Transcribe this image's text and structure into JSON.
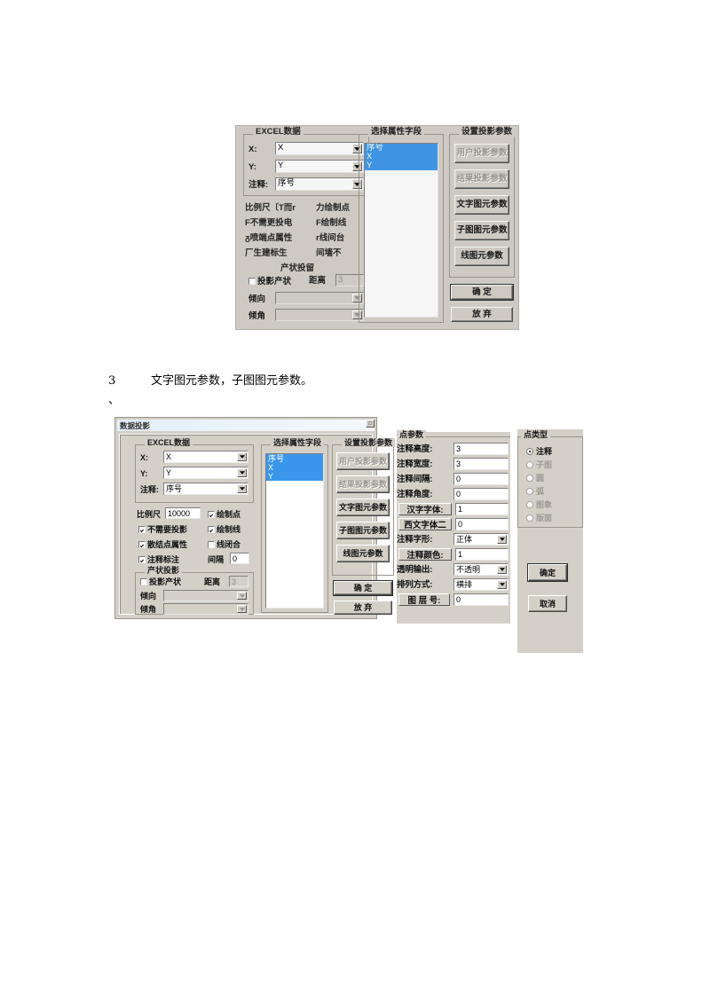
{
  "document": {
    "paragraph_number": "3",
    "paragraph_text": "文字图元参数，子图图元参数。",
    "trailing_mark": "、"
  },
  "top_screenshot": {
    "excel_group": {
      "title": "EXCEL数据",
      "rows": [
        {
          "label": "X:",
          "value": "X"
        },
        {
          "label": "Y:",
          "value": "Y"
        },
        {
          "label": "注释:",
          "value": "序号"
        }
      ]
    },
    "options_text": [
      "比例尺〔T而r",
      "力绘制点",
      "F不需更投电",
      "F绘制线",
      "ᵹ喷端点属性",
      "r线间台",
      "厂生建标生",
      "间墙不"
    ],
    "attitude_group": {
      "title": "产状投留",
      "checkbox_label": "投影产状",
      "distance_label": "距离",
      "distance_value": "3",
      "dip_direction_label": "倾向",
      "dip_angle_label": "倾角"
    },
    "field_list": {
      "title": "选择属性字段",
      "items": [
        {
          "label": "序号",
          "selected": true
        },
        {
          "label": "X",
          "selected": true
        },
        {
          "label": "Y",
          "selected": true
        }
      ]
    },
    "projection_group": {
      "title": "设置投影参数",
      "buttons": [
        {
          "label": "用户投影参数",
          "disabled": true
        },
        {
          "label": "结果投影参数",
          "disabled": true
        },
        {
          "label": "文字图元参数",
          "disabled": false
        },
        {
          "label": "子图图元参数",
          "disabled": false
        },
        {
          "label": "线图元参数",
          "disabled": false
        }
      ]
    },
    "ok_label": "确  定",
    "cancel_label": "放  弃"
  },
  "dialog": {
    "title": "数据投影",
    "close_glyph": "□",
    "excel_group": {
      "title": "EXCEL数据",
      "rows": [
        {
          "label": "X:",
          "value": "X"
        },
        {
          "label": "Y:",
          "value": "Y"
        },
        {
          "label": "注释:",
          "value": "序号"
        }
      ]
    },
    "scale_label": "比例尺",
    "scale_value": "10000",
    "interval_label": "间隔",
    "interval_value": "0",
    "checkboxes": [
      {
        "label": "绘制点",
        "checked": true
      },
      {
        "label": "不需要投影",
        "checked": true
      },
      {
        "label": "绘制线",
        "checked": true
      },
      {
        "label": "散结点属性",
        "checked": true
      },
      {
        "label": "线闭合",
        "checked": false
      },
      {
        "label": "注释标注",
        "checked": true
      }
    ],
    "attitude_group": {
      "title": "产状投影",
      "checkbox_label": "投影产状",
      "checked": false,
      "distance_label": "距离",
      "distance_value": "3",
      "dip_direction_label": "倾向",
      "dip_direction_value": "",
      "dip_angle_label": "倾角",
      "dip_angle_value": ""
    },
    "field_list": {
      "title": "选择属性字段",
      "items": [
        {
          "label": "序号",
          "selected": true
        },
        {
          "label": "X",
          "selected": true
        },
        {
          "label": "Y",
          "selected": true
        }
      ]
    },
    "projection_group": {
      "title": "设置投影参数",
      "buttons": [
        {
          "label": "用户投影参数",
          "disabled": true
        },
        {
          "label": "结果投影参数",
          "disabled": true
        },
        {
          "label": "文字图元参数",
          "disabled": false
        },
        {
          "label": "子图图元参数",
          "disabled": false
        },
        {
          "label": "线图元参数",
          "disabled": false
        }
      ]
    },
    "ok_label": "确  定",
    "cancel_label": "放  弃"
  },
  "point_params": {
    "title": "点参数",
    "rows": [
      {
        "label": "注释高度:",
        "value": "3",
        "kind": "text"
      },
      {
        "label": "注释宽度:",
        "value": "3",
        "kind": "text"
      },
      {
        "label": "注释间隔:",
        "value": "0",
        "kind": "text"
      },
      {
        "label": "注释角度:",
        "value": "0",
        "kind": "text"
      },
      {
        "label": "汉字字体:",
        "value": "1",
        "kind": "button-label"
      },
      {
        "label": "西文字体二",
        "value": "0",
        "kind": "button-label"
      },
      {
        "label": "注释字形:",
        "value": "正体",
        "kind": "combo"
      },
      {
        "label": "注释颜色:",
        "value": "1",
        "kind": "button-label"
      },
      {
        "label": "透明输出:",
        "value": "不透明",
        "kind": "combo"
      },
      {
        "label": "排列方式:",
        "value": "横排",
        "kind": "combo"
      },
      {
        "label": "图 层 号:",
        "value": "0",
        "kind": "text"
      }
    ]
  },
  "point_type": {
    "title": "点类型",
    "options": [
      {
        "label": "注释",
        "selected": true,
        "disabled": false
      },
      {
        "label": "子图",
        "selected": false,
        "disabled": true
      },
      {
        "label": "圆",
        "selected": false,
        "disabled": true
      },
      {
        "label": "弧",
        "selected": false,
        "disabled": true
      },
      {
        "label": "图象",
        "selected": false,
        "disabled": true
      },
      {
        "label": "版面",
        "selected": false,
        "disabled": true
      }
    ],
    "ok_label": "确定",
    "cancel_label": "取消"
  },
  "colors": {
    "selection_blue": "#3a96eb",
    "window_face": "#d4d0c8",
    "field_white": "#ffffff",
    "disabled_text": "#8d8a84"
  }
}
